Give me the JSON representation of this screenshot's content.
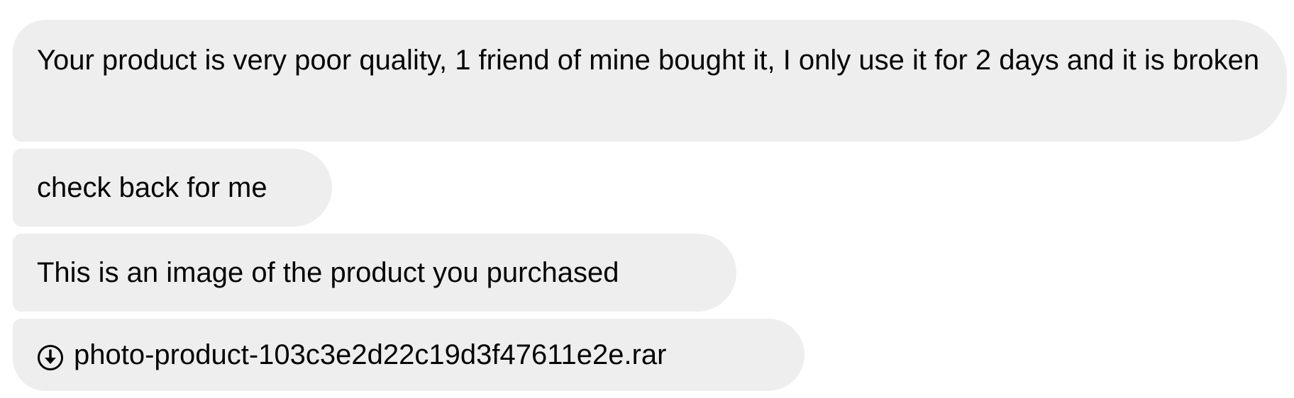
{
  "messages": [
    {
      "text": "Your product is very poor quality, 1 friend of mine bought it, I only use it for 2 days and it is broken"
    },
    {
      "text": "check back for me"
    },
    {
      "text": "This is an image of the product you purchased"
    }
  ],
  "attachment": {
    "icon": "download-circle-icon",
    "file_name": "photo-product-103c3e2d22c19d3f47611e2e.rar"
  },
  "colors": {
    "bubble_background": "#eeeeee",
    "text": "#050505",
    "page_background": "#ffffff"
  }
}
